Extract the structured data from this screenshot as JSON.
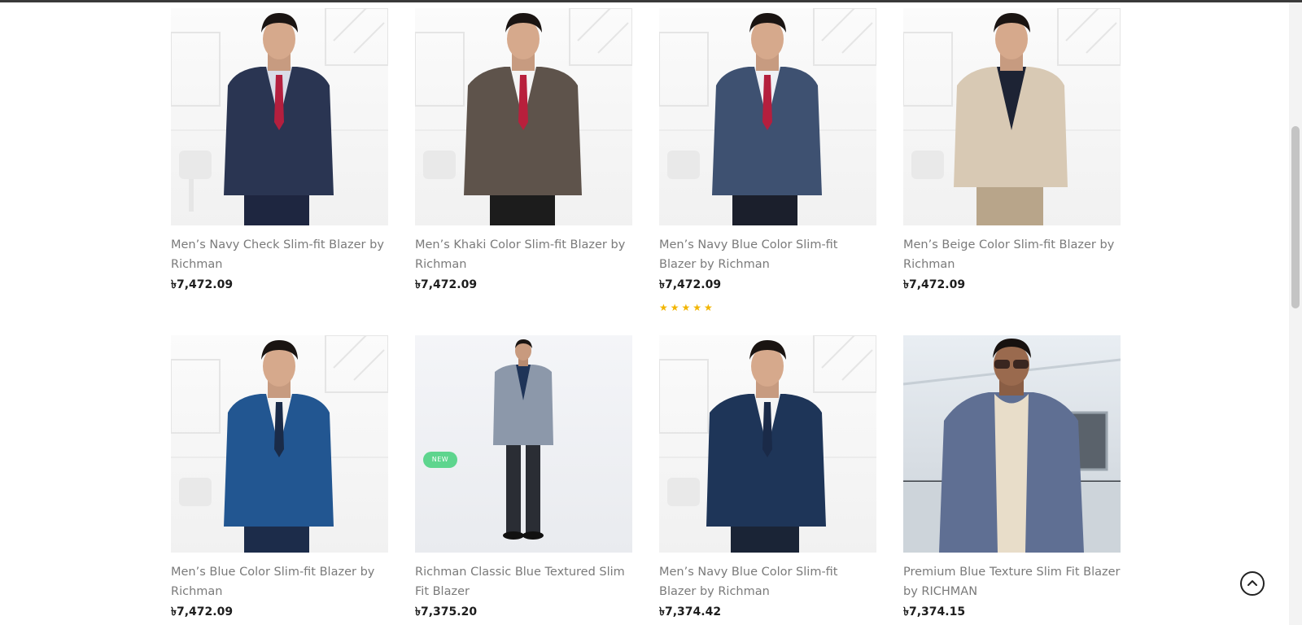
{
  "products": [
    {
      "title": "Men’s Navy Check Slim-fit Blazer by Richman",
      "price": "৳7,472.09",
      "suit_color": "#2a3552",
      "tie_color": "#b41f3e",
      "shirt_color": "#d9dde8",
      "pants_color": "#1e2640"
    },
    {
      "title": "Men’s Khaki Color Slim-fit Blazer by Richman",
      "price": "৳7,472.09",
      "suit_color": "#5e534b",
      "tie_color": "#b8203c",
      "shirt_color": "#f4f4f4",
      "pants_color": "#1c1c1c"
    },
    {
      "title": "Men’s Navy Blue Color Slim-fit Blazer by Richman",
      "price": "৳7,472.09",
      "suit_color": "#3e5171",
      "tie_color": "#b41f3e",
      "shirt_color": "#eef0f5",
      "pants_color": "#1b1f2c",
      "rating": 5,
      "stars": "★★★★★"
    },
    {
      "title": "Men’s Beige Color Slim-fit Blazer by Richman",
      "price": "৳7,472.09",
      "suit_color": "#d8c9b4",
      "tie_color": "#1d2334",
      "shirt_color": "#1d2334",
      "pants_color": "#b8a58a"
    },
    {
      "title": "Men’s Blue Color Slim-fit Blazer by Richman",
      "price": "৳7,472.09",
      "suit_color": "#225691",
      "tie_color": "#1a2b48",
      "shirt_color": "#f4f4f4",
      "pants_color": "#1c2c4a"
    },
    {
      "title": "Richman Classic Blue Textured Slim Fit Blazer",
      "price": "৳7,375.20",
      "badge": "NEW",
      "suit_color": "#8c98aa",
      "tie_color": "#1f3458",
      "shirt_color": "#1f3458",
      "pants_color": "#2a2d34"
    },
    {
      "title": "Men’s Navy Blue Color Slim-fit Blazer by Richman",
      "price": "৳7,374.42",
      "suit_color": "#1e3558",
      "tie_color": "#1a2a48",
      "shirt_color": "#f4f4f4",
      "pants_color": "#1a2436"
    },
    {
      "title": "Premium Blue Texture Slim Fit Blazer by RICHMAN",
      "price": "৳7,374.15",
      "suit_color": "#5f6f93",
      "tie_color": "#e8ddc9",
      "shirt_color": "#e8ddc9",
      "pants_color": "#4a556e"
    }
  ],
  "colors": {
    "price": "#1d1d1d",
    "title": "#7a7a7a",
    "badge_bg": "#5ed58e",
    "star": "#f2b500"
  },
  "icons": {
    "back_to_top": "chevron-up-icon"
  }
}
